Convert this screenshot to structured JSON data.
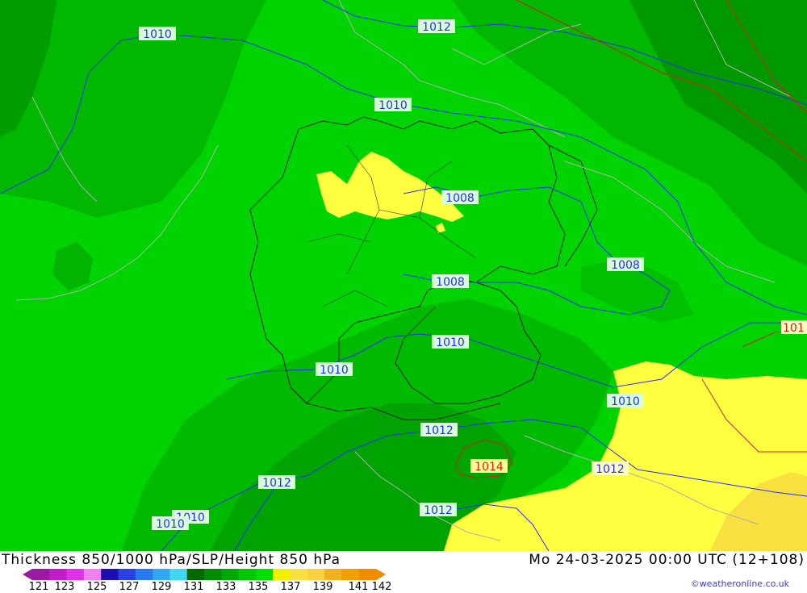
{
  "map": {
    "isobar_labels": [
      {
        "text": "1010",
        "color": "#2a2aff"
      },
      {
        "text": "1012",
        "color": "#2a2aff"
      },
      {
        "text": "1010",
        "color": "#2a2aff"
      },
      {
        "text": "1008",
        "color": "#2a2aff"
      },
      {
        "text": "1008",
        "color": "#2a2aff"
      },
      {
        "text": "1008",
        "color": "#2a2aff"
      },
      {
        "text": "1010",
        "color": "#2a2aff"
      },
      {
        "text": "1010",
        "color": "#2a2aff"
      },
      {
        "text": "1010",
        "color": "#2a2aff"
      },
      {
        "text": "1012",
        "color": "#2a2aff"
      },
      {
        "text": "1014",
        "color": "#d02020"
      },
      {
        "text": "1012",
        "color": "#2a2aff"
      },
      {
        "text": "1012",
        "color": "#2a2aff"
      },
      {
        "text": "1012",
        "color": "#2a2aff"
      },
      {
        "text": "1010",
        "color": "#2a2aff"
      },
      {
        "text": "1010",
        "color": "#2a2aff"
      },
      {
        "text": "101",
        "color": "#d02020"
      }
    ]
  },
  "footer": {
    "title": "Thickness 850/1000 hPa/SLP/Height 850 hPa",
    "datetime": "Mo 24-03-2025 00:00 UTC (12+108)",
    "credit": "©weatheronline.co.uk"
  },
  "legend": {
    "ticks": [
      "121",
      "123",
      "125",
      "127",
      "129",
      "131",
      "133",
      "135",
      "137",
      "139",
      "141",
      "142"
    ],
    "colors": [
      "#9a1aa0",
      "#c21cc8",
      "#e030e8",
      "#f080f0",
      "#1a10b0",
      "#2a40e0",
      "#2878f0",
      "#30a8f0",
      "#40d8f0",
      "#006a00",
      "#008c00",
      "#00aa00",
      "#00c800",
      "#00e000",
      "#f0f000",
      "#f8e040",
      "#f8d040",
      "#f0b020",
      "#f0a000",
      "#f08c00"
    ]
  }
}
